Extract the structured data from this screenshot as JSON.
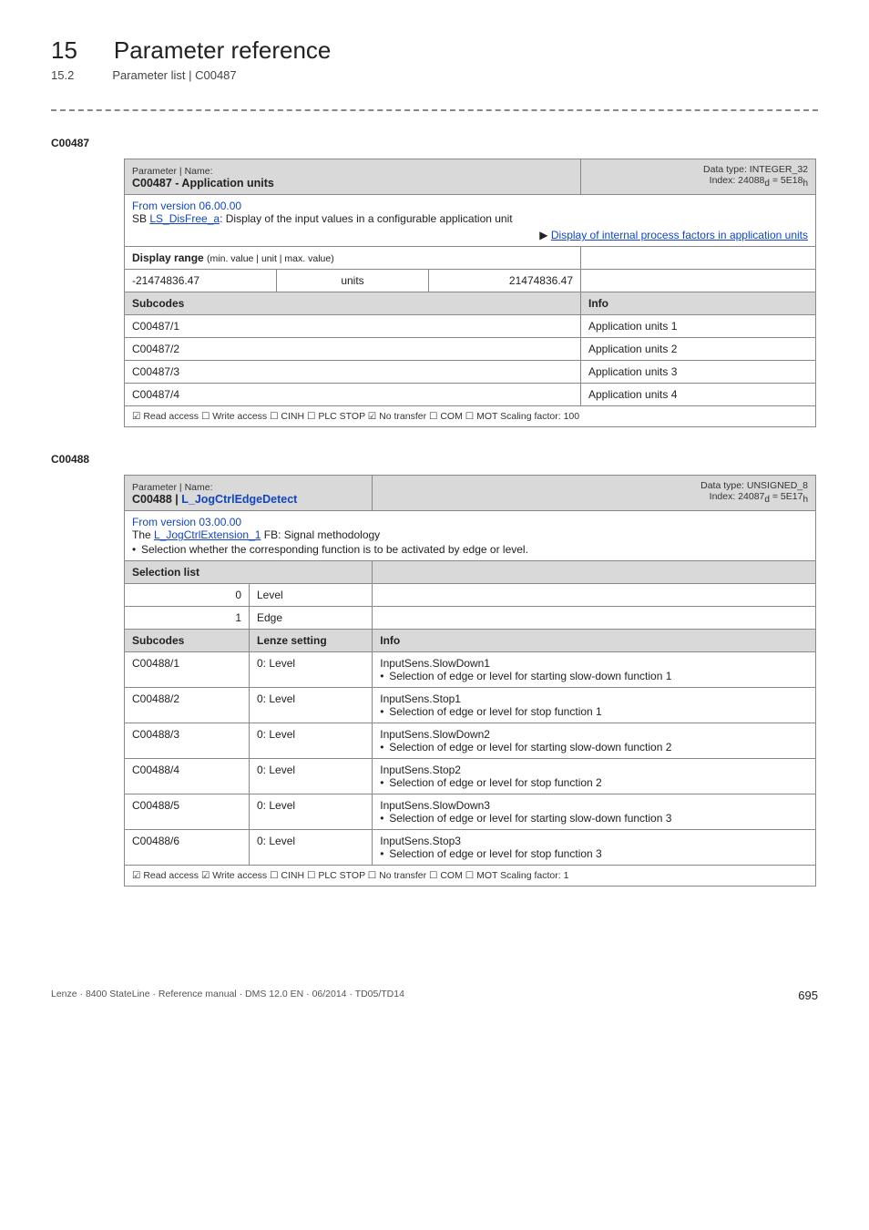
{
  "chapter": {
    "number": "15",
    "title": "Parameter reference"
  },
  "subhead": {
    "number": "15.2",
    "title": "Parameter list | C00487"
  },
  "sec1": {
    "code": "C00487",
    "pname_label": "Parameter | Name:",
    "pname": "C00487 - Application units",
    "dtype_line1": "Data type: INTEGER_32",
    "dtype_line2_pre": "Index: 24088",
    "dtype_line2_d": "d",
    "dtype_line2_mid": " = 5E18",
    "dtype_line2_h": "h",
    "from_version": "From version 06.00.00",
    "sb_pre": "SB ",
    "sb_link": "LS_DisFree_a",
    "sb_post": ": Display of the input values in a configurable application unit",
    "display_link_pre": "▶ ",
    "display_link": "Display of internal process factors in application units",
    "display_range_label": "Display range ",
    "display_range_small": "(min. value | unit | max. value)",
    "range_min": "-21474836.47",
    "range_unit": "units",
    "range_max": "21474836.47",
    "subcodes_hdr": "Subcodes",
    "info_hdr": "Info",
    "rows": [
      {
        "c": "C00487/1",
        "info": "Application units 1"
      },
      {
        "c": "C00487/2",
        "info": "Application units 2"
      },
      {
        "c": "C00487/3",
        "info": "Application units 3"
      },
      {
        "c": "C00487/4",
        "info": "Application units 4"
      }
    ],
    "checks": "☑ Read access   ☐ Write access   ☐ CINH   ☐ PLC STOP   ☑ No transfer   ☐ COM   ☐ MOT     Scaling factor: 100"
  },
  "sec2": {
    "code": "C00488",
    "pname_label": "Parameter | Name:",
    "pname_pre": "C00488 | ",
    "pname_link": "L_JogCtrlEdgeDetect",
    "dtype_line1": "Data type: UNSIGNED_8",
    "dtype_line2_pre": "Index: 24087",
    "dtype_line2_d": "d",
    "dtype_line2_mid": " = 5E17",
    "dtype_line2_h": "h",
    "from_version": "From version 03.00.00",
    "desc_pre": "The ",
    "desc_link": "L_JogCtrlExtension_1",
    "desc_post": " FB: Signal methodology",
    "desc_bullet": "Selection whether the corresponding function is to be activated by edge or level.",
    "sel_list_hdr": "Selection list",
    "sel0_n": "0",
    "sel0_v": "Level",
    "sel1_n": "1",
    "sel1_v": "Edge",
    "subcodes_hdr": "Subcodes",
    "lenze_hdr": "Lenze setting",
    "info_hdr": "Info",
    "rows": [
      {
        "c": "C00488/1",
        "set": "0: Level",
        "title": "InputSens.SlowDown1",
        "b": "Selection of edge or level for starting slow-down function 1"
      },
      {
        "c": "C00488/2",
        "set": "0: Level",
        "title": "InputSens.Stop1",
        "b": "Selection of edge or level for stop function 1"
      },
      {
        "c": "C00488/3",
        "set": "0: Level",
        "title": "InputSens.SlowDown2",
        "b": "Selection of edge or level for starting slow-down function 2"
      },
      {
        "c": "C00488/4",
        "set": "0: Level",
        "title": "InputSens.Stop2",
        "b": "Selection of edge or level for stop function 2"
      },
      {
        "c": "C00488/5",
        "set": "0: Level",
        "title": "InputSens.SlowDown3",
        "b": "Selection of edge or level for starting slow-down function 3"
      },
      {
        "c": "C00488/6",
        "set": "0: Level",
        "title": "InputSens.Stop3",
        "b": "Selection of edge or level for stop function 3"
      }
    ],
    "checks": "☑ Read access   ☑ Write access   ☐ CINH   ☐ PLC STOP   ☐ No transfer   ☐ COM   ☐ MOT     Scaling factor: 1"
  },
  "footer": {
    "left": "Lenze · 8400 StateLine · Reference manual · DMS 12.0 EN · 06/2014 · TD05/TD14",
    "page": "695"
  }
}
